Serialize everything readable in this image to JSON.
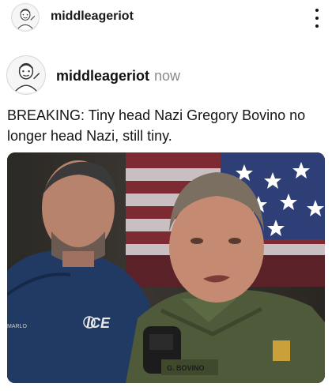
{
  "top_bar": {
    "username": "middleageriot",
    "avatar_icon": "cartoon-man-portrait-icon",
    "more_icon": "vertical-ellipsis-icon"
  },
  "post": {
    "username": "middleageriot",
    "timestamp": "now",
    "avatar_icon": "cartoon-man-portrait-icon",
    "text": "BREAKING: Tiny head Nazi Gregory Bovino no longer head Nazi, still tiny.",
    "photo": {
      "jacket_logo": "ICE",
      "sleeve_text": "MARLO",
      "name_tape": "G. BOVINO"
    }
  },
  "colors": {
    "username_text": "#1a1a1a",
    "timestamp_text": "#8a8a8a",
    "background": "#ffffff"
  }
}
